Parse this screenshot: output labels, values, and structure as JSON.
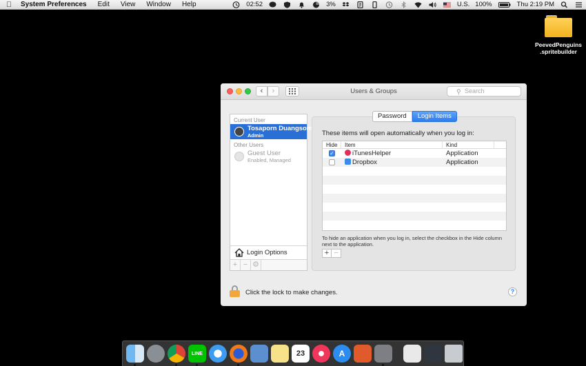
{
  "menubar": {
    "app_name": "System Preferences",
    "menus": [
      "Edit",
      "View",
      "Window",
      "Help"
    ],
    "clock_timer": "02:52",
    "battery_small": "3%",
    "input_source": "U.S.",
    "battery": "100%",
    "datetime": "Thu 2:19 PM"
  },
  "desktop": {
    "folder_label_line1": "PeevedPenguins",
    "folder_label_line2": ".spritebuilder"
  },
  "window": {
    "title": "Users & Groups",
    "search_placeholder": "Search"
  },
  "sidebar": {
    "current_user_label": "Current User",
    "current_user": {
      "name": "Tosaporn Duangsom",
      "role": "Admin"
    },
    "other_users_label": "Other Users",
    "guest_user": {
      "name": "Guest User",
      "role": "Enabled, Managed"
    },
    "login_options": "Login Options"
  },
  "tabs": {
    "password": "Password",
    "login_items": "Login Items"
  },
  "login_items": {
    "intro": "These items will open automatically when you log in:",
    "headers": {
      "hide": "Hide",
      "item": "Item",
      "kind": "Kind"
    },
    "rows": [
      {
        "name": "iTunesHelper",
        "kind": "Application",
        "hidden": true
      },
      {
        "name": "Dropbox",
        "kind": "Application",
        "hidden": false
      }
    ],
    "hint": "To hide an application when you log in, select the checkbox in the Hide column next to the application."
  },
  "footer": {
    "lock_text": "Click the lock to make changes."
  },
  "colors": {
    "selection": "#2a6fd5",
    "tab_active": "#2c7df0",
    "lock": "#f3a73a"
  }
}
